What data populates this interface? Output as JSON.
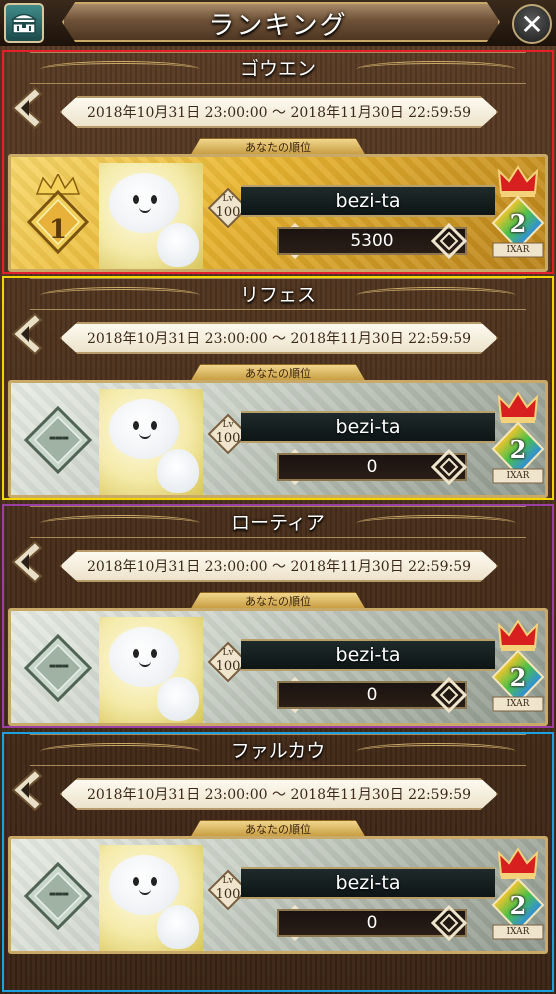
{
  "header": {
    "title": "ランキング",
    "menu_icon": "treasure-chest-icon",
    "close_icon": "close-icon"
  },
  "sections": [
    {
      "name": "ゴウエン",
      "period": "2018年10月31日 23:00:00 ～ 2018年11月30日 22:59:59",
      "rank_label": "あなたの順位",
      "rank": "1",
      "level_prefix": "Lv",
      "level": "100",
      "player_name": "bezi-ta",
      "score": "5300",
      "crown_rank": "2",
      "crown_text": "IXAR",
      "card_style": "gold",
      "highlight_color": "#e4212b"
    },
    {
      "name": "リフェス",
      "period": "2018年10月31日 23:00:00 ～ 2018年11月30日 22:59:59",
      "rank_label": "あなたの順位",
      "rank": "---",
      "level_prefix": "Lv",
      "level": "100",
      "player_name": "bezi-ta",
      "score": "0",
      "crown_rank": "2",
      "crown_text": "IXAR",
      "card_style": "silver",
      "highlight_color": "#f2d400"
    },
    {
      "name": "ローティア",
      "period": "2018年10月31日 23:00:00 ～ 2018年11月30日 22:59:59",
      "rank_label": "あなたの順位",
      "rank": "---",
      "level_prefix": "Lv",
      "level": "100",
      "player_name": "bezi-ta",
      "score": "0",
      "crown_rank": "2",
      "crown_text": "IXAR",
      "card_style": "silver",
      "highlight_color": "#9b3fa6"
    },
    {
      "name": "ファルカウ",
      "period": "2018年10月31日 23:00:00 ～ 2018年11月30日 22:59:59",
      "rank_label": "あなたの順位",
      "rank": "---",
      "level_prefix": "Lv",
      "level": "100",
      "player_name": "bezi-ta",
      "score": "0",
      "crown_rank": "2",
      "crown_text": "IXAR",
      "card_style": "silver",
      "highlight_color": "#1ea0e0"
    }
  ]
}
